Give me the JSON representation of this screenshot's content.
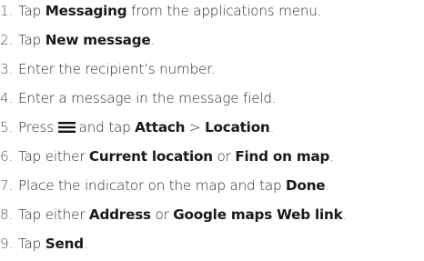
{
  "steps": [
    {
      "num": "1.",
      "segments": [
        {
          "text": "Tap ",
          "bold": false
        },
        {
          "text": "Messaging",
          "bold": true
        },
        {
          "text": " from the applications menu.",
          "bold": false
        }
      ]
    },
    {
      "num": "2.",
      "segments": [
        {
          "text": "Tap ",
          "bold": false
        },
        {
          "text": "New message",
          "bold": true
        },
        {
          "text": ".",
          "bold": false
        }
      ]
    },
    {
      "num": "3.",
      "segments": [
        {
          "text": "Enter the recipient’s number.",
          "bold": false
        }
      ]
    },
    {
      "num": "4.",
      "segments": [
        {
          "text": "Enter a message in the message field.",
          "bold": false
        }
      ]
    },
    {
      "num": "5.",
      "segments": [
        {
          "text": "Press ",
          "bold": false
        },
        {
          "text": "",
          "bold": false,
          "icon": "menu-icon"
        },
        {
          "text": "and tap ",
          "bold": false
        },
        {
          "text": "Attach",
          "bold": true
        },
        {
          "text": " > ",
          "bold": false
        },
        {
          "text": "Location",
          "bold": true
        },
        {
          "text": ".",
          "bold": false
        }
      ]
    },
    {
      "num": "6.",
      "segments": [
        {
          "text": "Tap either ",
          "bold": false
        },
        {
          "text": "Current location",
          "bold": true
        },
        {
          "text": " or ",
          "bold": false
        },
        {
          "text": "Find on map",
          "bold": true
        },
        {
          "text": ".",
          "bold": false
        }
      ]
    },
    {
      "num": "7.",
      "segments": [
        {
          "text": "Place the indicator on the map and tap ",
          "bold": false
        },
        {
          "text": "Done",
          "bold": true
        },
        {
          "text": ".",
          "bold": false
        }
      ]
    },
    {
      "num": "8.",
      "segments": [
        {
          "text": "Tap either ",
          "bold": false
        },
        {
          "text": "Address",
          "bold": true
        },
        {
          "text": " or ",
          "bold": false
        },
        {
          "text": "Google maps Web link",
          "bold": true
        },
        {
          "text": ".",
          "bold": false
        }
      ]
    },
    {
      "num": "9.",
      "segments": [
        {
          "text": "Tap ",
          "bold": false
        },
        {
          "text": "Send",
          "bold": true
        },
        {
          "text": ".",
          "bold": false
        }
      ]
    }
  ]
}
